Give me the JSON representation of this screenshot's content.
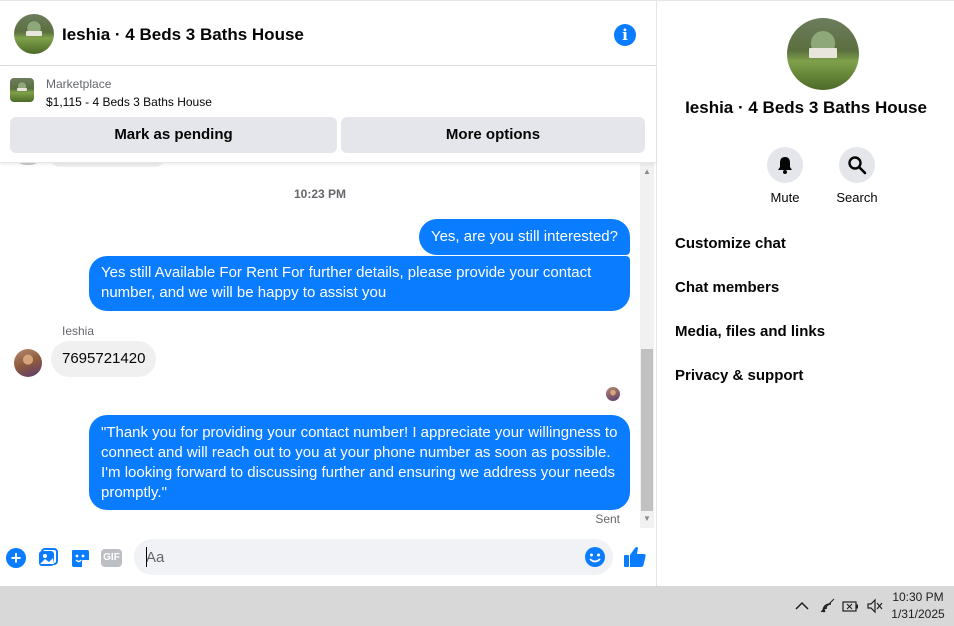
{
  "header": {
    "title": "Ieshia · 4 Beds 3 Baths House",
    "info_icon": "info-icon"
  },
  "marketplace": {
    "label": "Marketplace",
    "item": "$1,115 - 4 Beds 3 Baths House",
    "buttons": {
      "pending": "Mark as pending",
      "more": "More options"
    }
  },
  "messages": {
    "timestamp": "10:23 PM",
    "outgoing_1": "Yes, are you still interested?",
    "outgoing_2": "Yes still Available For Rent For  further details, please provide your contact number, and we will be happy to assist you",
    "sender_name": "Ieshia",
    "incoming_1": "7695721420",
    "outgoing_3": "\"Thank you for providing your contact number! I appreciate your willingness to connect and will reach out to you at your phone number as soon as possible. I'm looking forward to discussing further and ensuring we address your needs promptly.\"",
    "status": "Sent"
  },
  "composer": {
    "placeholder": "Aa"
  },
  "sidebar": {
    "title": "Ieshia · 4 Beds 3 Baths House",
    "actions": {
      "mute": "Mute",
      "search": "Search"
    },
    "menu": [
      "Customize chat",
      "Chat members",
      "Media, files and links",
      "Privacy & support"
    ]
  },
  "taskbar": {
    "time": "10:30 PM",
    "date": "1/31/2025"
  },
  "colors": {
    "accent": "#0a7cff",
    "incoming_bubble": "#f0f0f0",
    "button_bg": "#e4e6eb"
  }
}
